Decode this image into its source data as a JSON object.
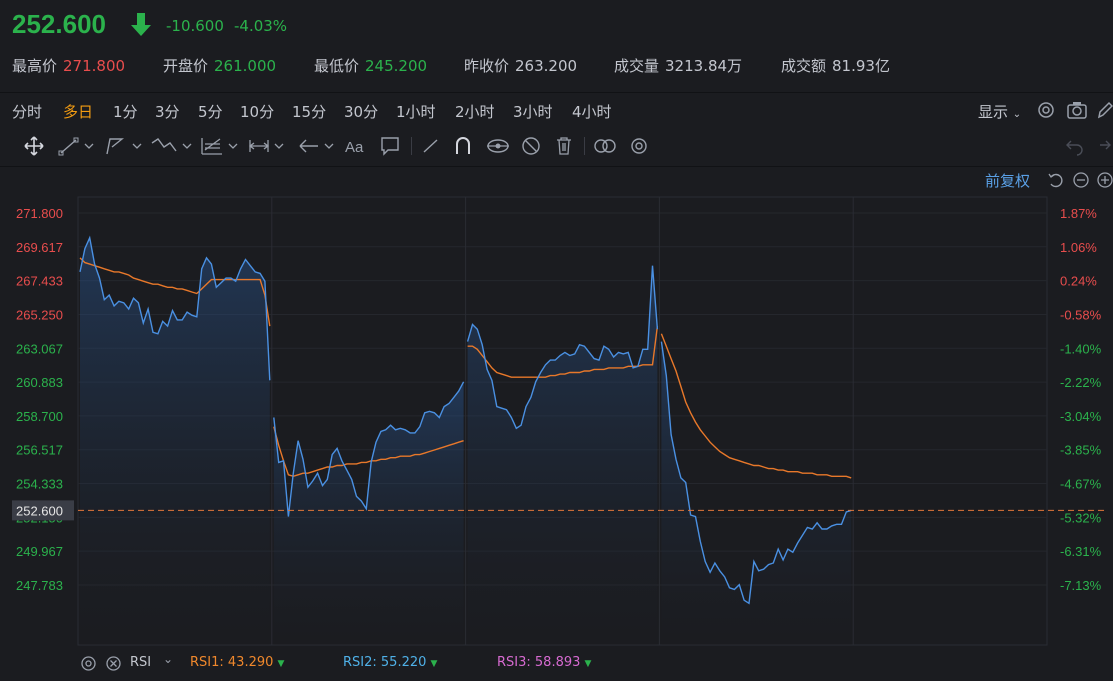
{
  "quote": {
    "price": "252.600",
    "change": "-10.600",
    "change_pct": "-4.03%",
    "stats": [
      {
        "label": "最高价",
        "value": "271.800",
        "tone": "red"
      },
      {
        "label": "开盘价",
        "value": "261.000",
        "tone": "green"
      },
      {
        "label": "最低价",
        "value": "245.200",
        "tone": "green"
      },
      {
        "label": "昨收价",
        "value": "263.200",
        "tone": "plain"
      },
      {
        "label": "成交量",
        "value": "3213.84万",
        "tone": "plain"
      },
      {
        "label": "成交额",
        "value": "81.93亿",
        "tone": "plain"
      }
    ]
  },
  "timeframes": [
    "分时",
    "多日",
    "1分",
    "3分",
    "5分",
    "10分",
    "15分",
    "30分",
    "1小时",
    "2小时",
    "3小时",
    "4小时"
  ],
  "active_timeframe": "多日",
  "toolbar": {
    "display_label": "显示",
    "adjust_label": "前复权",
    "tools": [
      "move-icon",
      "line-tool-icon",
      "polyline-tool-icon",
      "wave-tool-icon",
      "fib-tool-icon",
      "measure-tool-icon",
      "arrow-tool-icon",
      "text-tool-icon",
      "comment-tool-icon",
      "pen-icon",
      "magnet-icon",
      "eye-icon",
      "hide-icon",
      "trash-icon",
      "link-icon",
      "settings-icon"
    ]
  },
  "colors": {
    "up": "#e84d4d",
    "down": "#2bb24c",
    "price_line": "#4a90e2",
    "avg_line": "#e8782a",
    "accent": "#f39c12"
  },
  "chart_data": {
    "type": "line",
    "ylim": [
      245.2,
      271.8
    ],
    "reference_price": 263.2,
    "current_price": 252.6,
    "current_price_label": "252.600",
    "y_ticks_left": [
      "271.800",
      "269.617",
      "267.433",
      "265.250",
      "263.067",
      "260.883",
      "258.700",
      "256.517",
      "254.333",
      "252.150",
      "249.967",
      "247.783"
    ],
    "y_tick_values": [
      271.8,
      269.617,
      267.433,
      265.25,
      263.067,
      260.883,
      258.7,
      256.517,
      254.333,
      252.15,
      249.967,
      247.783
    ],
    "y_ticks_right": [
      "1.87%",
      "1.06%",
      "0.24%",
      "-0.58%",
      "-1.40%",
      "-2.22%",
      "-3.04%",
      "-3.85%",
      "-4.67%",
      "-5.32%",
      "-6.31%",
      "-7.13%"
    ],
    "days": 5,
    "series": [
      {
        "values": [
          [
            268.0,
            269.5,
            270.2,
            268.5,
            267.6,
            266.2,
            266.5,
            265.8,
            266.1,
            266.0,
            265.6,
            266.3,
            266.0,
            264.7,
            265.6,
            264.1,
            264.0,
            264.8,
            264.5,
            265.5,
            264.9,
            264.9,
            265.4,
            265.2,
            265.1,
            268.2,
            268.9,
            268.5,
            267.0,
            267.3,
            267.6,
            267.6,
            267.4,
            268.2,
            268.8,
            268.4,
            268.0,
            267.9,
            267.4,
            261.0
          ],
          [
            258.6,
            255.7,
            255.8,
            252.2,
            255.0,
            257.1,
            255.9,
            254.1,
            254.5,
            255.0,
            254.2,
            254.6,
            256.2,
            256.6,
            255.8,
            255.2,
            254.6,
            253.5,
            253.2,
            252.7,
            255.7,
            257.0,
            257.7,
            257.8,
            258.1,
            257.8,
            257.9,
            257.8,
            257.6,
            257.6,
            258.0,
            258.9,
            259.0,
            258.9,
            258.6,
            259.3,
            259.5,
            259.9,
            260.3,
            260.9
          ],
          [
            263.5,
            264.6,
            264.3,
            263.3,
            261.7,
            261.0,
            259.3,
            259.2,
            259.1,
            258.6,
            257.9,
            258.1,
            259.3,
            259.9,
            260.9,
            261.5,
            262.0,
            262.3,
            262.3,
            262.6,
            262.8,
            262.6,
            262.7,
            263.3,
            263.2,
            262.8,
            262.4,
            262.3,
            263.2,
            263.0,
            262.5,
            262.8,
            262.7,
            262.8,
            261.8,
            261.9,
            263.0,
            263.0,
            268.4,
            264.3
          ],
          [
            263.5,
            261.3,
            257.5,
            255.9,
            254.7,
            254.4,
            252.3,
            252.2,
            250.6,
            249.3,
            248.6,
            249.2,
            248.7,
            248.3,
            247.6,
            247.5,
            247.8,
            246.8,
            246.6,
            249.3,
            248.7,
            248.8,
            249.1,
            249.2,
            250.1,
            249.4,
            250.1,
            249.9,
            250.5,
            251.0,
            251.5,
            251.4,
            251.8,
            251.4,
            251.4,
            251.6,
            251.7,
            251.7,
            252.5,
            252.6
          ]
        ]
      },
      {
        "values": [
          [
            268.9,
            268.6,
            268.5,
            268.4,
            268.3,
            268.2,
            268.1,
            268.0,
            268.0,
            267.9,
            267.8,
            267.6,
            267.5,
            267.4,
            267.3,
            267.2,
            267.2,
            267.1,
            267.0,
            267.0,
            266.9,
            266.9,
            266.8,
            266.7,
            266.6,
            266.9,
            267.2,
            267.5,
            267.5,
            267.5,
            267.5,
            267.5,
            267.5,
            267.5,
            267.5,
            267.5,
            267.5,
            267.5,
            266.5,
            264.5
          ],
          [
            258.0,
            256.8,
            255.8,
            254.9,
            254.8,
            254.9,
            255.0,
            255.0,
            255.1,
            255.2,
            255.3,
            255.4,
            255.4,
            255.5,
            255.5,
            255.6,
            255.6,
            255.6,
            255.7,
            255.7,
            255.8,
            255.8,
            255.9,
            255.9,
            256.0,
            256.0,
            256.1,
            256.1,
            256.1,
            256.2,
            256.2,
            256.3,
            256.4,
            256.5,
            256.6,
            256.7,
            256.8,
            256.9,
            257.0,
            257.1
          ],
          [
            263.2,
            263.2,
            263.0,
            262.6,
            262.2,
            261.8,
            261.5,
            261.4,
            261.3,
            261.2,
            261.2,
            261.2,
            261.2,
            261.2,
            261.2,
            261.2,
            261.2,
            261.3,
            261.3,
            261.4,
            261.4,
            261.5,
            261.5,
            261.5,
            261.6,
            261.6,
            261.7,
            261.7,
            261.7,
            261.8,
            261.8,
            261.8,
            261.8,
            261.9,
            261.9,
            261.9,
            262.0,
            262.0,
            262.0,
            264.5
          ],
          [
            264.0,
            263.2,
            262.4,
            261.6,
            260.6,
            259.6,
            258.9,
            258.3,
            257.8,
            257.4,
            257.0,
            256.7,
            256.4,
            256.2,
            256.0,
            255.9,
            255.8,
            255.7,
            255.6,
            255.5,
            255.5,
            255.4,
            255.3,
            255.3,
            255.2,
            255.2,
            255.1,
            255.1,
            255.1,
            255.0,
            255.0,
            255.0,
            254.9,
            254.9,
            254.9,
            254.8,
            254.8,
            254.8,
            254.8,
            254.7
          ]
        ]
      }
    ],
    "indicator": {
      "name": "RSI",
      "values": [
        {
          "label": "RSI1",
          "value": "43.290",
          "color": "#f0882c"
        },
        {
          "label": "RSI2",
          "value": "55.220",
          "color": "#4fb1e8"
        },
        {
          "label": "RSI3",
          "value": "58.893",
          "color": "#d66ad0"
        }
      ]
    }
  }
}
